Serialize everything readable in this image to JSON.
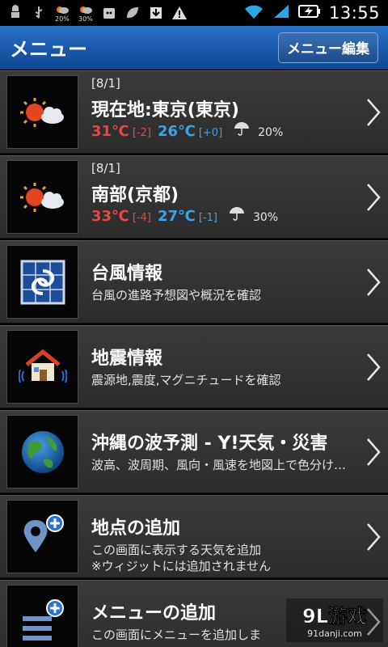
{
  "status_bar": {
    "time": "13:55",
    "icons": [
      "android-debug-icon",
      "usb-icon",
      "weather-20-icon",
      "weather-30-icon",
      "cat-app-icon",
      "leaf-icon",
      "download-icon",
      "warning-icon"
    ],
    "mini_temps": [
      "20%",
      "30%"
    ]
  },
  "header": {
    "title": "メニュー",
    "edit_button": "メニュー編集",
    "color": "#1f62b4"
  },
  "items": [
    {
      "date": "[8/1]",
      "title": "現在地:東京(東京)",
      "high": "31℃",
      "high_diff": "[-2]",
      "low": "26℃",
      "low_diff": "[+0]",
      "rain": "20%",
      "icon": "sun-cloud-icon"
    },
    {
      "date": "[8/1]",
      "title": "南部(京都)",
      "high": "33℃",
      "high_diff": "[-4]",
      "low": "27℃",
      "low_diff": "[-1]",
      "rain": "30%",
      "icon": "sun-cloud-icon"
    },
    {
      "title": "台風情報",
      "sub1": "台風の進路予想図や概況を確認",
      "icon": "typhoon-icon"
    },
    {
      "title": "地震情報",
      "sub1": "震源地,震度,マグニチュードを確認",
      "icon": "house-quake-icon"
    },
    {
      "title": "沖縄の波予測 - Y!天気・災害",
      "sub1": "波高、波周期、風向・風速を地図上で色分け…",
      "icon": "globe-icon"
    },
    {
      "title": "地点の追加",
      "sub1": "この画面に表示する天気を追加",
      "sub2": "※ウィジットには追加されません",
      "icon": "add-location-icon"
    },
    {
      "title": "メニューの追加",
      "sub1": "この画面にメニューを追加しま",
      "icon": "add-menu-icon"
    }
  ],
  "watermark": {
    "brand": "9L游戏",
    "url": "91danji.com"
  },
  "colors": {
    "high_temp": "#e84747",
    "low_temp": "#3ba4e8",
    "accent": "#1f62b4"
  }
}
